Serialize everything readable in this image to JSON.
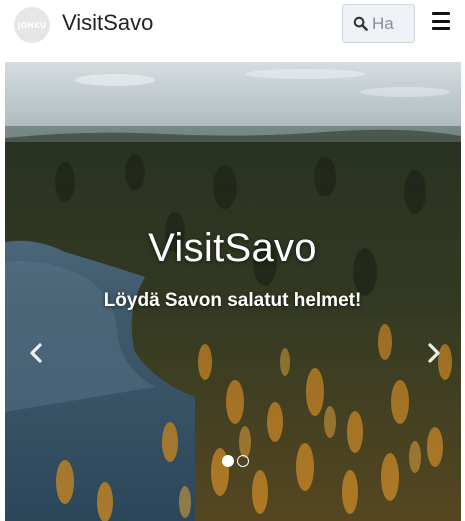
{
  "header": {
    "logo_text": "JOHKU",
    "brand": "VisitSavo",
    "search": {
      "placeholder": "Ha"
    }
  },
  "hero": {
    "title": "VisitSavo",
    "subtitle": "Löydä Savon salatut helmet!",
    "slide_count": 2,
    "active_slide": 1
  },
  "icons": [
    "search-icon",
    "menu-icon",
    "chevron-left-icon",
    "chevron-right-icon"
  ],
  "colors": {
    "search_bg": "#eef1f5",
    "sky": "#b9c7cf",
    "lake": "#3b5b72",
    "forest_dark": "#1f2a1a",
    "autumn_orange": "#c98a2a"
  }
}
